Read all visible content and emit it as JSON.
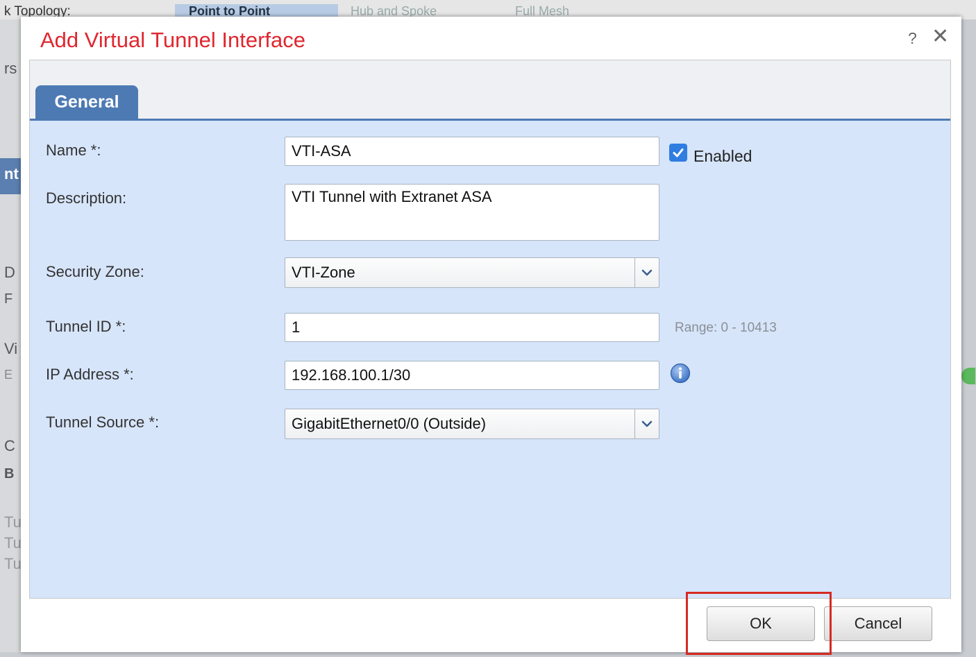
{
  "background": {
    "topology_label": "k Topology:",
    "topology_options": [
      "Point to Point",
      "Hub and Spoke",
      "Full Mesh"
    ],
    "left_fragments": [
      "rs",
      "nt",
      "D",
      "F",
      "Vi",
      "E",
      "C",
      "B",
      "Tu",
      "Tu",
      "Tu"
    ]
  },
  "dialog": {
    "title": "Add Virtual Tunnel Interface",
    "help": "?",
    "close": "✕",
    "tab": "General",
    "fields": {
      "name_label": "Name *:",
      "name_value": "VTI-ASA",
      "enabled_label": "Enabled",
      "enabled_checked": true,
      "description_label": "Description:",
      "description_value": "VTI Tunnel with Extranet ASA",
      "security_zone_label": "Security Zone:",
      "security_zone_value": "VTI-Zone",
      "tunnel_id_label": "Tunnel ID *:",
      "tunnel_id_value": "1",
      "tunnel_id_range": "Range: 0 - 10413",
      "ip_address_label": "IP Address *:",
      "ip_address_value": "192.168.100.1/30",
      "tunnel_source_label": "Tunnel Source *:",
      "tunnel_source_value": "GigabitEthernet0/0 (Outside)"
    },
    "buttons": {
      "ok": "OK",
      "cancel": "Cancel"
    },
    "colors": {
      "title": "#e0262f",
      "tab": "#4d7ab3",
      "form_background": "#d6e5fa",
      "checkbox": "#2f7de1",
      "highlight": "#d62a22"
    }
  }
}
